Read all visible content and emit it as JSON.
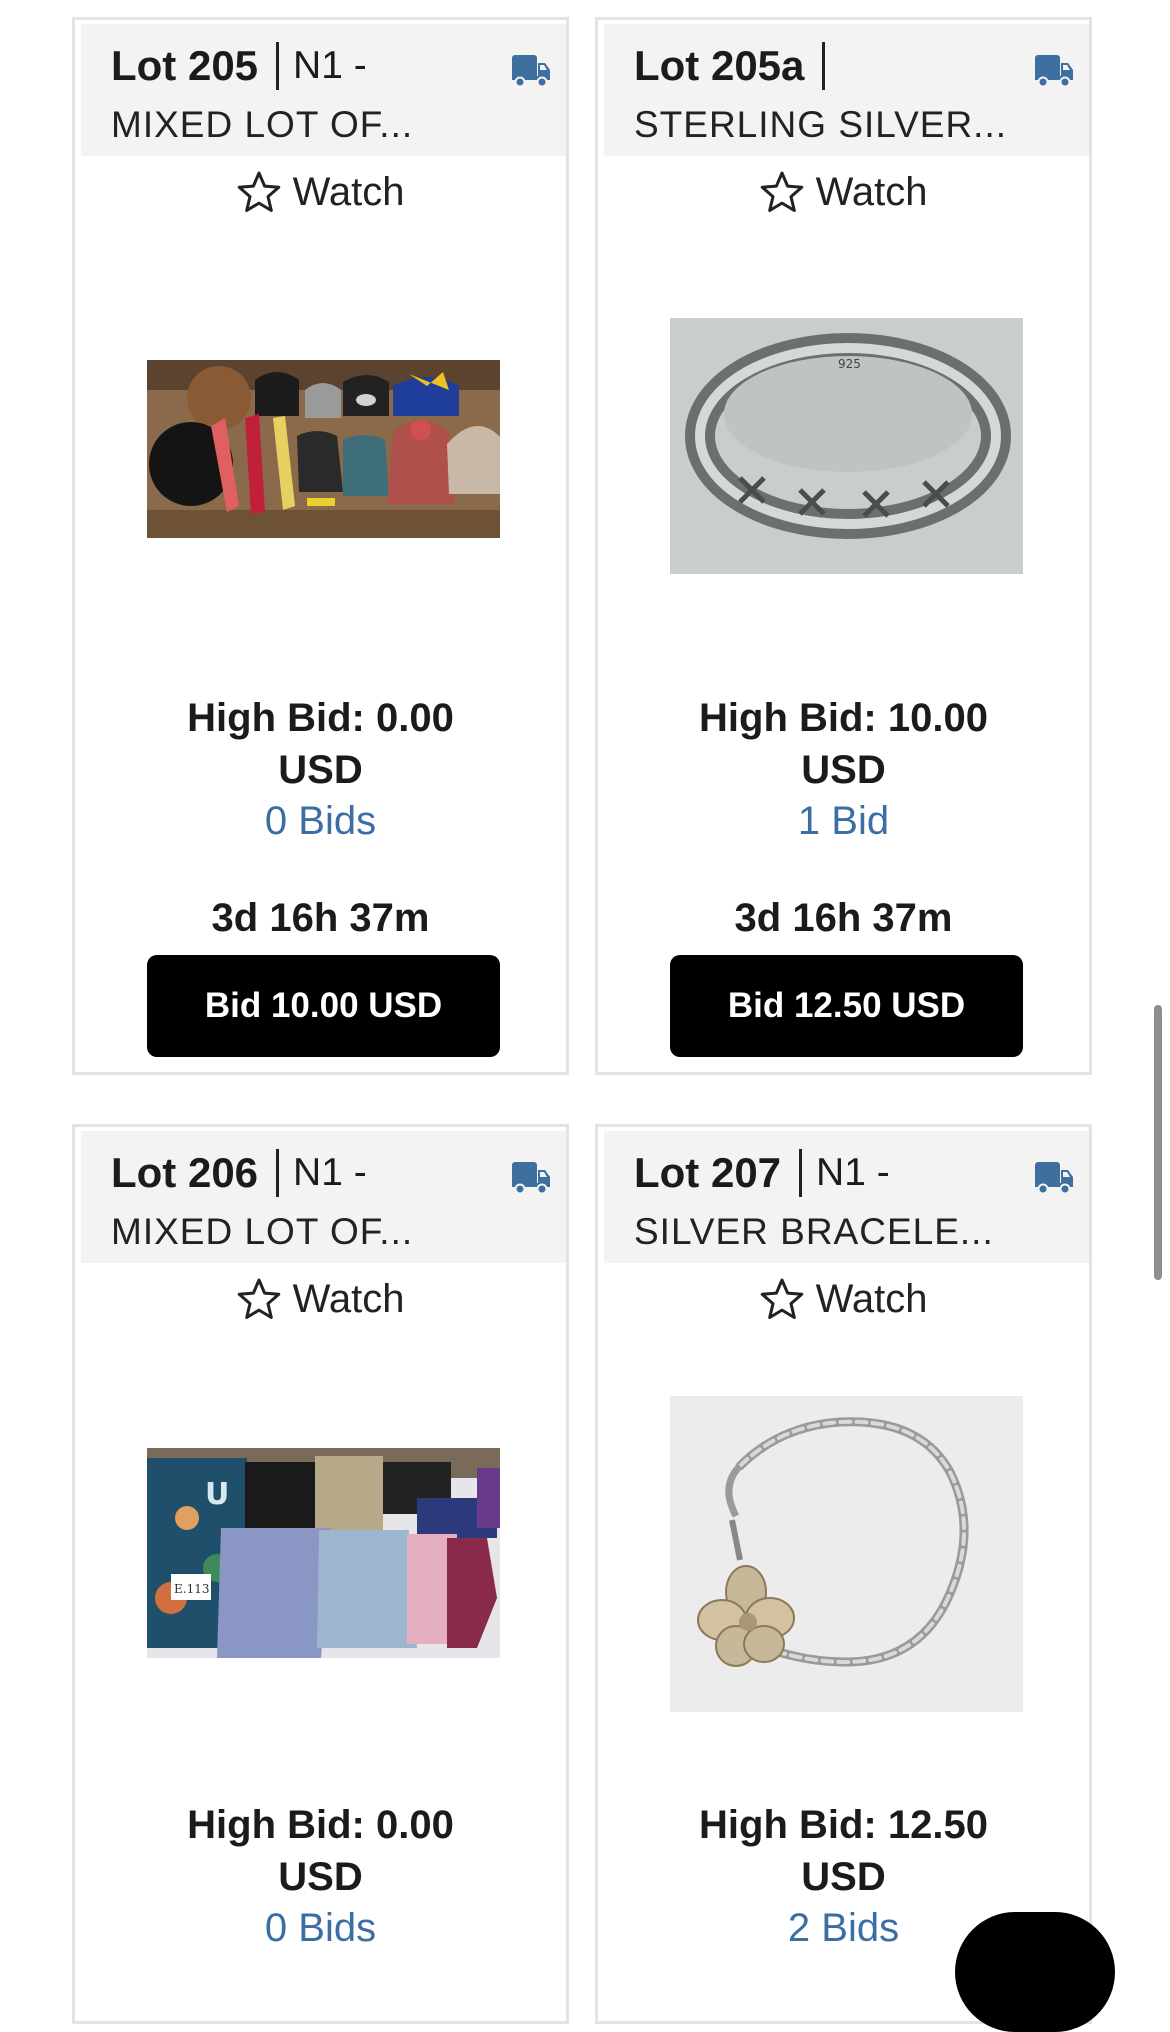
{
  "lots": [
    {
      "lot_number": "Lot 205",
      "code": "N1 -",
      "title": "MIXED LOT OF...",
      "watch_label": "Watch",
      "high_bid_line1": "High Bid: 0.00",
      "high_bid_line2": "USD",
      "bids": "0 Bids",
      "time_left": "3d 16h 37m",
      "bid_button": "Bid 10.00 USD",
      "image": "hats, ties, gloves and beanies on a table"
    },
    {
      "lot_number": "Lot 205a",
      "code": "",
      "title": "STERLING SILVER...",
      "watch_label": "Watch",
      "high_bid_line1": "High Bid: 10.00",
      "high_bid_line2": "USD",
      "bids": "1 Bid",
      "time_left": "3d 16h 37m",
      "bid_button": "Bid 12.50 USD",
      "image": "sterling silver band ring stamped 925"
    },
    {
      "lot_number": "Lot 206",
      "code": "N1 -",
      "title": "MIXED LOT OF...",
      "watch_label": "Watch",
      "high_bid_line1": "High Bid: 0.00",
      "high_bid_line2": "USD",
      "bids": "0 Bids",
      "image": "folded clothing and jeans on a table"
    },
    {
      "lot_number": "Lot 207",
      "code": "N1 -",
      "title": "SILVER BRACELE...",
      "watch_label": "Watch",
      "high_bid_line1": "High Bid: 12.50",
      "high_bid_line2": "USD",
      "bids": "2 Bids",
      "image": "silver curb chain bracelet with flower charm"
    }
  ],
  "ring_stamp": "925",
  "tag_text": "E.113",
  "colors": {
    "link": "#3a6ea5",
    "truck_icon": "#3f6f9f",
    "button_bg": "#000000",
    "header_bg": "#f3f3f4"
  },
  "icons": [
    "truck-icon",
    "star-icon"
  ]
}
